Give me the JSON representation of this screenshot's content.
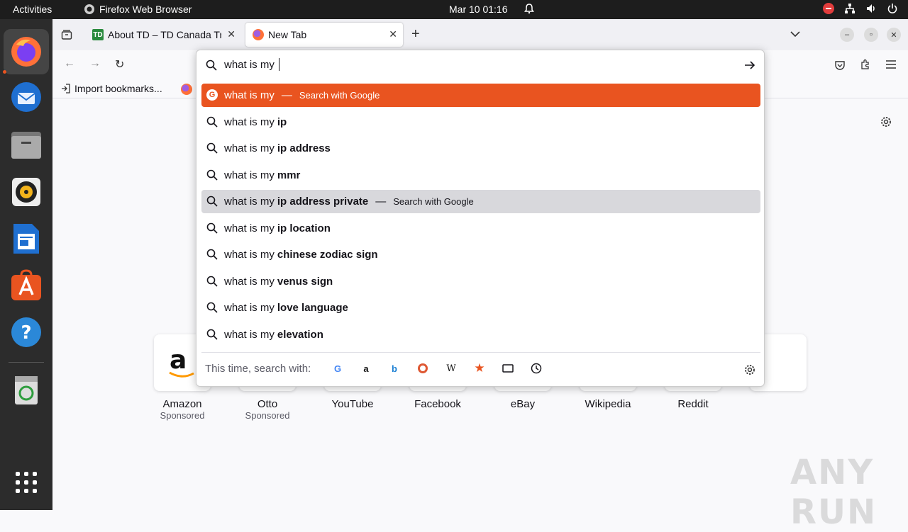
{
  "topbar": {
    "activities": "Activities",
    "app_name": "Firefox Web Browser",
    "clock": "Mar 10  01:16"
  },
  "tabs": [
    {
      "title": "About TD – TD Canada Tr",
      "favicon": "td-logo"
    },
    {
      "title": "New Tab",
      "favicon": "firefox-icon"
    }
  ],
  "bookmarks": {
    "import_label": "Import bookmarks..."
  },
  "urlbar": {
    "value": "what is my"
  },
  "suggestions": [
    {
      "prefix": "what is my",
      "bold": "",
      "action": "Search with Google",
      "state": "highlighted"
    },
    {
      "prefix": "what is my",
      "bold": "ip",
      "action": "",
      "state": ""
    },
    {
      "prefix": "what is my",
      "bold": "ip address",
      "action": "",
      "state": ""
    },
    {
      "prefix": "what is my",
      "bold": "mmr",
      "action": "",
      "state": ""
    },
    {
      "prefix": "what is my",
      "bold": "ip address private",
      "action": "Search with Google",
      "state": "selected"
    },
    {
      "prefix": "what is my",
      "bold": "ip location",
      "action": "",
      "state": ""
    },
    {
      "prefix": "what is my",
      "bold": "chinese zodiac sign",
      "action": "",
      "state": ""
    },
    {
      "prefix": "what is my",
      "bold": "venus sign",
      "action": "",
      "state": ""
    },
    {
      "prefix": "what is my",
      "bold": "love language",
      "action": "",
      "state": ""
    },
    {
      "prefix": "what is my",
      "bold": "elevation",
      "action": "",
      "state": ""
    }
  ],
  "oneoff": {
    "label": "This time, search with:",
    "engines": [
      "google-icon",
      "amazon-icon",
      "bing-icon",
      "duckduckgo-icon",
      "wikipedia-icon",
      "bookmarks-star-icon",
      "tabs-icon",
      "history-icon"
    ]
  },
  "top_sites": [
    {
      "name": "Amazon",
      "sub": "Sponsored"
    },
    {
      "name": "Otto",
      "sub": "Sponsored"
    },
    {
      "name": "YouTube",
      "sub": ""
    },
    {
      "name": "Facebook",
      "sub": ""
    },
    {
      "name": "eBay",
      "sub": ""
    },
    {
      "name": "Wikipedia",
      "sub": ""
    },
    {
      "name": "Reddit",
      "sub": ""
    }
  ],
  "watermark": "ANY RUN",
  "colors": {
    "accent": "#e95420",
    "topbar": "#1d1d1d",
    "dock": "#2c2c2c",
    "selected_row": "#d8d8dc"
  }
}
